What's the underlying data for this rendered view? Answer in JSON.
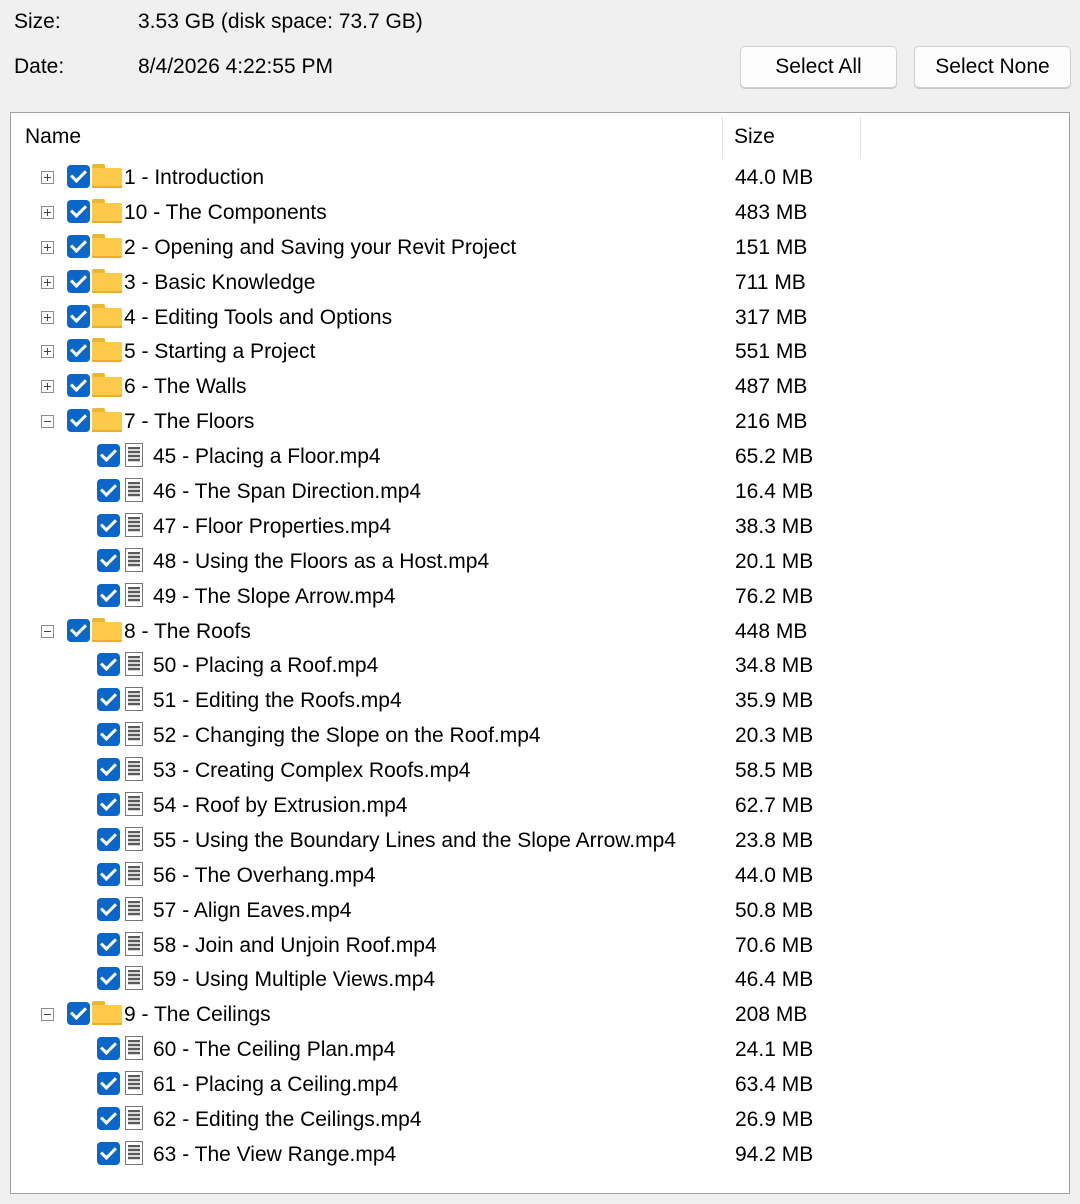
{
  "info": {
    "size_label": "Size:",
    "size_value": "3.53 GB (disk space: 73.7 GB)",
    "date_label": "Date:",
    "date_value": "8/4/2026 4:22:55 PM"
  },
  "buttons": {
    "select_all": "Select All",
    "select_none": "Select None"
  },
  "columns": {
    "name": "Name",
    "size": "Size"
  },
  "items": [
    {
      "type": "folder",
      "expanded": false,
      "checked": true,
      "name": "1 - Introduction",
      "size": "44.0 MB"
    },
    {
      "type": "folder",
      "expanded": false,
      "checked": true,
      "name": "10 - The Components",
      "size": "483 MB"
    },
    {
      "type": "folder",
      "expanded": false,
      "checked": true,
      "name": "2 - Opening and Saving your Revit Project",
      "size": "151 MB"
    },
    {
      "type": "folder",
      "expanded": false,
      "checked": true,
      "name": "3 - Basic Knowledge",
      "size": "711 MB"
    },
    {
      "type": "folder",
      "expanded": false,
      "checked": true,
      "name": "4 - Editing Tools and Options",
      "size": "317 MB"
    },
    {
      "type": "folder",
      "expanded": false,
      "checked": true,
      "name": "5 - Starting a Project",
      "size": "551 MB"
    },
    {
      "type": "folder",
      "expanded": false,
      "checked": true,
      "name": "6 - The Walls",
      "size": "487 MB"
    },
    {
      "type": "folder",
      "expanded": true,
      "checked": true,
      "name": "7 - The Floors",
      "size": "216 MB"
    },
    {
      "type": "file",
      "checked": true,
      "name": "45 - Placing a Floor.mp4",
      "size": "65.2 MB"
    },
    {
      "type": "file",
      "checked": true,
      "name": "46 - The Span Direction.mp4",
      "size": "16.4 MB"
    },
    {
      "type": "file",
      "checked": true,
      "name": "47 - Floor Properties.mp4",
      "size": "38.3 MB"
    },
    {
      "type": "file",
      "checked": true,
      "name": "48 - Using the Floors as a Host.mp4",
      "size": "20.1 MB"
    },
    {
      "type": "file",
      "checked": true,
      "name": "49 - The Slope Arrow.mp4",
      "size": "76.2 MB"
    },
    {
      "type": "folder",
      "expanded": true,
      "checked": true,
      "name": "8 - The Roofs",
      "size": "448 MB"
    },
    {
      "type": "file",
      "checked": true,
      "name": "50 - Placing a Roof.mp4",
      "size": "34.8 MB"
    },
    {
      "type": "file",
      "checked": true,
      "name": "51 - Editing the Roofs.mp4",
      "size": "35.9 MB"
    },
    {
      "type": "file",
      "checked": true,
      "name": "52 - Changing the Slope on the Roof.mp4",
      "size": "20.3 MB"
    },
    {
      "type": "file",
      "checked": true,
      "name": "53 - Creating Complex Roofs.mp4",
      "size": "58.5 MB"
    },
    {
      "type": "file",
      "checked": true,
      "name": "54 - Roof by Extrusion.mp4",
      "size": "62.7 MB"
    },
    {
      "type": "file",
      "checked": true,
      "name": "55 - Using the Boundary Lines and the Slope Arrow.mp4",
      "size": "23.8 MB"
    },
    {
      "type": "file",
      "checked": true,
      "name": "56 - The Overhang.mp4",
      "size": "44.0 MB"
    },
    {
      "type": "file",
      "checked": true,
      "name": "57 - Align Eaves.mp4",
      "size": "50.8 MB"
    },
    {
      "type": "file",
      "checked": true,
      "name": "58 - Join and Unjoin Roof.mp4",
      "size": "70.6 MB"
    },
    {
      "type": "file",
      "checked": true,
      "name": "59 - Using Multiple Views.mp4",
      "size": "46.4 MB"
    },
    {
      "type": "folder",
      "expanded": true,
      "checked": true,
      "name": "9 - The Ceilings",
      "size": "208 MB"
    },
    {
      "type": "file",
      "checked": true,
      "name": "60 - The Ceiling Plan.mp4",
      "size": "24.1 MB"
    },
    {
      "type": "file",
      "checked": true,
      "name": "61 - Placing a Ceiling.mp4",
      "size": "63.4 MB"
    },
    {
      "type": "file",
      "checked": true,
      "name": "62 - Editing the Ceilings.mp4",
      "size": "26.9 MB"
    },
    {
      "type": "file",
      "checked": true,
      "name": "63 - The View Range.mp4",
      "size": "94.2 MB"
    }
  ]
}
